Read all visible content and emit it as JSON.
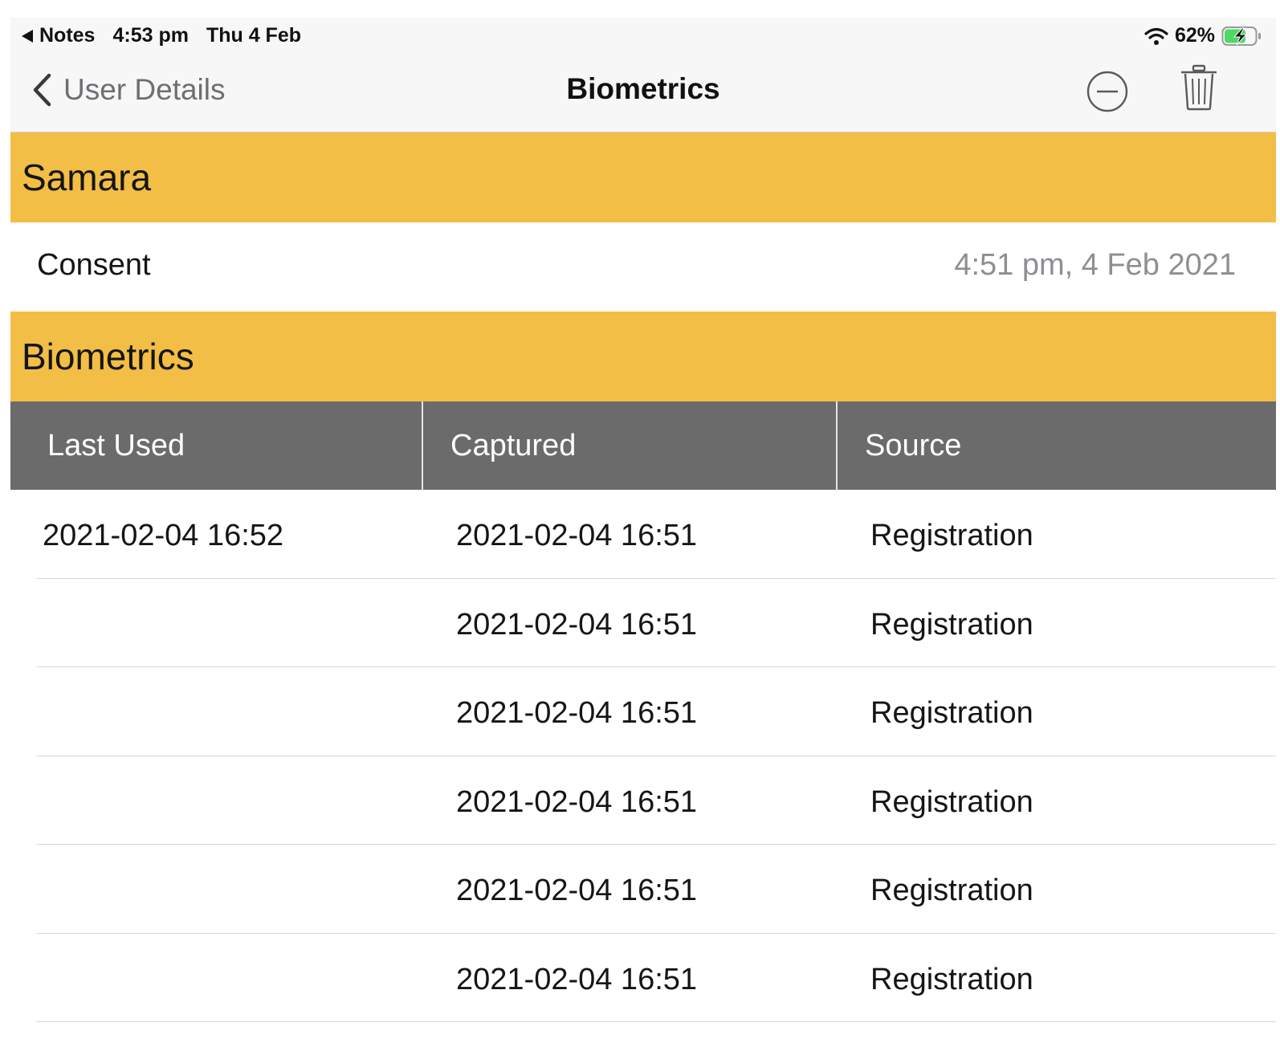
{
  "status_bar": {
    "back_app": "Notes",
    "time": "4:53 pm",
    "date": "Thu 4 Feb",
    "battery": "62%",
    "icons": [
      "back-triangle-icon",
      "wifi-icon",
      "battery-charging-icon"
    ]
  },
  "nav": {
    "back_label": "User Details",
    "title": "Biometrics",
    "icons": [
      "chevron-left-icon",
      "minus-circle-icon",
      "trash-icon"
    ]
  },
  "person_section": {
    "header": "Samara",
    "consent_label": "Consent",
    "consent_value": "4:51 pm, 4 Feb 2021"
  },
  "biometrics_section": {
    "header": "Biometrics",
    "columns": [
      "Last Used",
      "Captured",
      "Source"
    ],
    "rows": [
      [
        "2021-02-04 16:52",
        "2021-02-04 16:51",
        "Registration"
      ],
      [
        "",
        "2021-02-04 16:51",
        "Registration"
      ],
      [
        "",
        "2021-02-04 16:51",
        "Registration"
      ],
      [
        "",
        "2021-02-04 16:51",
        "Registration"
      ],
      [
        "",
        "2021-02-04 16:51",
        "Registration"
      ],
      [
        "",
        "2021-02-04 16:51",
        "Registration"
      ]
    ]
  },
  "colors": {
    "section_header": "#f2be45",
    "table_header": "#6b6b6b",
    "secondary_text": "#8e8e93",
    "battery_charge": "#4cd964"
  }
}
